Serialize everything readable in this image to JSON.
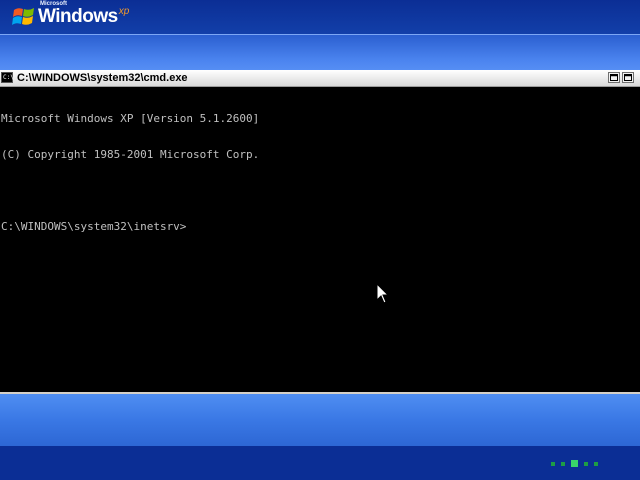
{
  "desktop": {
    "logo": {
      "microsoft": "Microsoft",
      "windows": "Windows",
      "xp": "xp"
    },
    "progress": {
      "active_index": 2,
      "count": 5,
      "color": "#39d56a"
    }
  },
  "cmd": {
    "title": "C:\\WINDOWS\\system32\\cmd.exe",
    "icon_label": "C:\\",
    "lines": [
      "Microsoft Windows XP [Version 5.1.2600]",
      "(C) Copyright 1985-2001 Microsoft Corp.",
      "",
      "C:\\WINDOWS\\system32\\inetsrv>"
    ]
  },
  "colors": {
    "background_dark": "#0b2e95",
    "background_light": "#4f8ef2",
    "console_bg": "#000000",
    "console_text": "#c0c0c0"
  }
}
